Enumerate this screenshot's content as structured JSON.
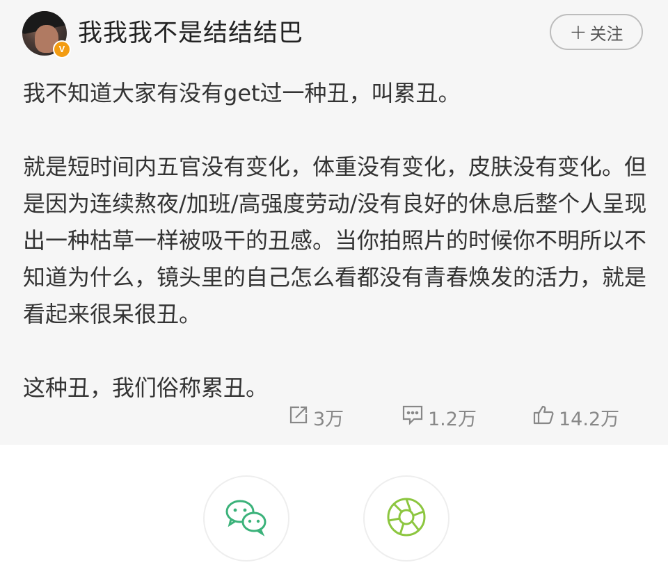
{
  "header": {
    "username": "我我我不是结结结巴",
    "verified_badge": "V",
    "follow_button": "关注",
    "follow_plus": "+"
  },
  "post": {
    "paragraphs": [
      "我不知道大家有没有get过一种丑，叫累丑。",
      "就是短时间内五官没有变化，体重没有变化，皮肤没有变化。但是因为连续熬夜/加班/高强度劳动/没有良好的休息后整个人呈现出一种枯草一样被吸干的丑感。当你拍照片的时候你不明所以不知道为什么，镜头里的自己怎么看都没有青春焕发的活力，就是看起来很呆很丑。",
      "这种丑，我们俗称累丑。"
    ]
  },
  "actions": {
    "repost_count": "3万",
    "comment_count": "1.2万",
    "like_count": "14.2万",
    "repost_icon": "repost-icon",
    "comment_icon": "comment-icon",
    "like_icon": "thumbs-up-icon"
  },
  "share": {
    "wechat_icon": "wechat-icon",
    "moments_icon": "wechat-moments-icon",
    "wechat_color": "#3bb27a",
    "moments_color": "#8cc63f"
  }
}
